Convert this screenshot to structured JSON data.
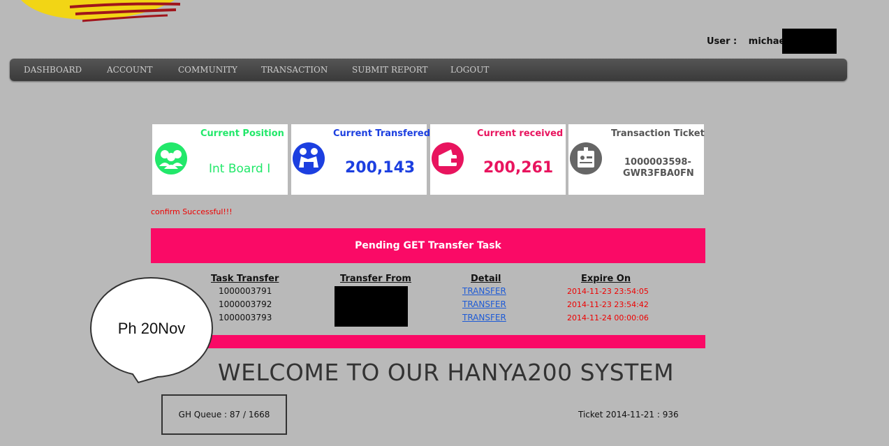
{
  "user": {
    "label": "User :",
    "name": "michaelg"
  },
  "nav": [
    "DASHBOARD",
    "ACCOUNT",
    "COMMUNITY",
    "TRANSACTION",
    "SUBMIT REPORT",
    "LOGOUT"
  ],
  "cards": [
    {
      "title": "Current Position",
      "value": "Int Board I",
      "color": "#22e86a",
      "icon": "group-icon"
    },
    {
      "title": "Current Transfered",
      "value": "200,143",
      "color": "#1c3fe0",
      "icon": "handshake-icon"
    },
    {
      "title": "Current received",
      "value": "200,261",
      "color": "#e8145e",
      "icon": "wallet-icon"
    },
    {
      "title": "Transaction Ticket",
      "value_line1": "1000003598-",
      "value_line2": "GWR3FBA0FN",
      "color": "#555555",
      "icon": "vip-card-icon"
    }
  ],
  "message": "confirm Successful!!!",
  "pending_title": "Pending GET Transfer Task",
  "table": {
    "headers": [
      "Task Transfer",
      "Transfer From",
      "Detail",
      "Expire On"
    ],
    "rows": [
      {
        "task": "1000003791",
        "detail": "TRANSFER",
        "expire": "2014-11-23 23:54:05"
      },
      {
        "task": "1000003792",
        "detail": "TRANSFER",
        "expire": "2014-11-23 23:54:42"
      },
      {
        "task": "1000003793",
        "detail": "TRANSFER",
        "expire": "2014-11-24 00:00:06"
      }
    ]
  },
  "bubble_text": "Ph 20Nov",
  "welcome": "WELCOME TO OUR HANYA200 SYSTEM",
  "gh_queue": "GH Queue : 87 / 1668",
  "ticket": "Ticket 2014-11-21 : 936"
}
